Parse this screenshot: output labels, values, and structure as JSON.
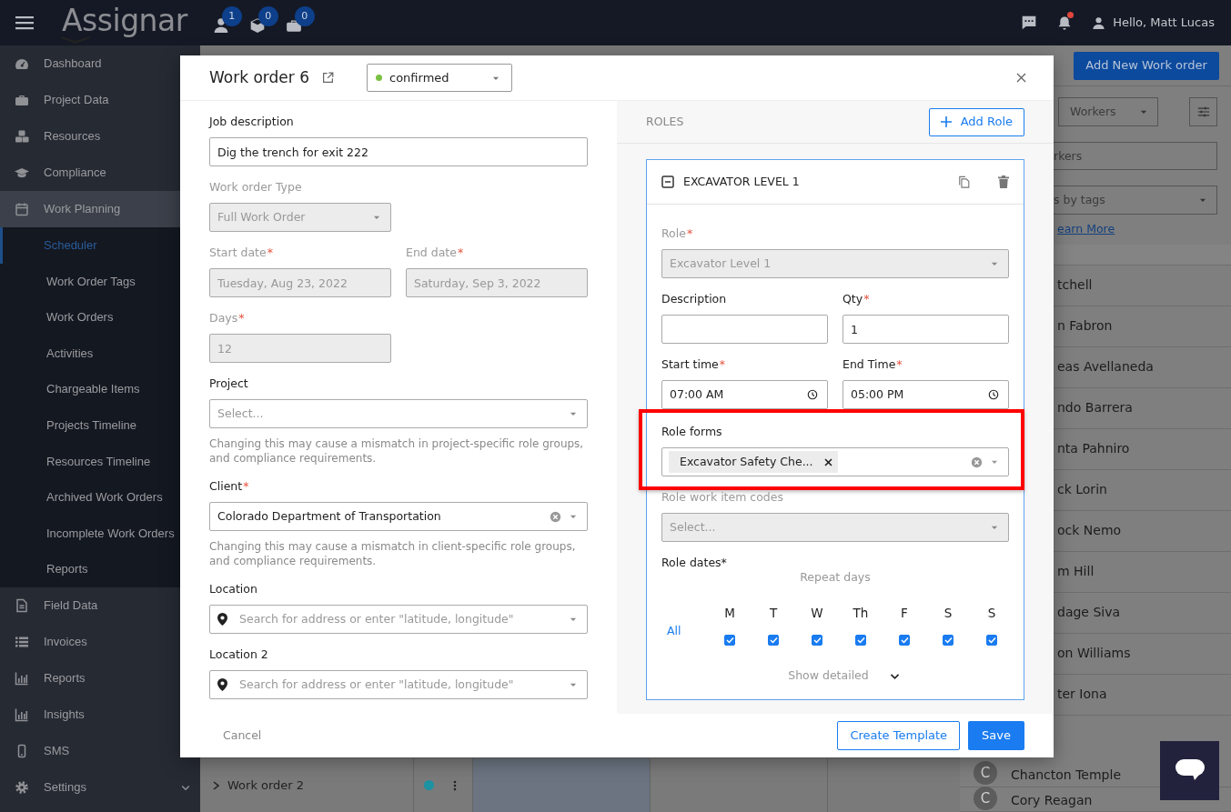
{
  "topbar": {
    "logo": "Assignar",
    "badges": [
      "1",
      "0",
      "0"
    ],
    "notification": true,
    "greeting": "Hello, Matt Lucas"
  },
  "sidebar": {
    "items": [
      {
        "label": "Dashboard",
        "selected": false
      },
      {
        "label": "Project Data",
        "selected": false
      },
      {
        "label": "Resources",
        "selected": false
      },
      {
        "label": "Compliance",
        "selected": false
      },
      {
        "label": "Work Planning",
        "selected": true,
        "expanded": true,
        "children": [
          {
            "label": "Scheduler",
            "selected": true
          },
          {
            "label": "Work Order Tags",
            "selected": false
          },
          {
            "label": "Work Orders",
            "selected": false
          },
          {
            "label": "Activities",
            "selected": false
          },
          {
            "label": "Chargeable Items",
            "selected": false
          },
          {
            "label": "Projects Timeline",
            "selected": false
          },
          {
            "label": "Resources Timeline",
            "selected": false
          },
          {
            "label": "Archived Work Orders",
            "selected": false
          },
          {
            "label": "Incomplete Work Orders",
            "selected": false
          },
          {
            "label": "Reports",
            "selected": false
          }
        ]
      },
      {
        "label": "Field Data",
        "selected": false
      },
      {
        "label": "Invoices",
        "selected": false
      },
      {
        "label": "Reports",
        "selected": false
      },
      {
        "label": "Insights",
        "selected": false
      },
      {
        "label": "SMS",
        "selected": false
      },
      {
        "label": "Settings",
        "selected": false,
        "expanded": false
      }
    ]
  },
  "scheduler_row": {
    "label": "Work order 2",
    "color": "#1b93a3"
  },
  "right_panel": {
    "add_button": "Add New Work order",
    "filter_select": "Workers",
    "search": {
      "placeholder": "rkers"
    },
    "tags_select": {
      "placeholder": "s by tags"
    },
    "link": "earn More",
    "workers": [
      {
        "name": "tchell"
      },
      {
        "name": "n Fabron"
      },
      {
        "name": "eas Avellaneda"
      },
      {
        "name": "ndo Barrera"
      },
      {
        "name": "nta Pahniro"
      },
      {
        "name": "ck Lorin"
      },
      {
        "name": "ock Nemo"
      },
      {
        "name": "m Hill"
      },
      {
        "name": "dage Siva"
      },
      {
        "name": "on Williams"
      },
      {
        "name": "ter Iona"
      },
      {
        "name": "Chancton Temple",
        "avatar": "C"
      },
      {
        "name": "Cory Reagan",
        "avatar": "C"
      }
    ]
  },
  "modal": {
    "title": "Work order 6",
    "status": {
      "value": "confirmed",
      "color": "#7ac143"
    },
    "rows": [
      [
        {
          "label": "Job description",
          "kind": "input",
          "value": "Dig the trench for exit 222"
        }
      ],
      [
        {
          "label": "Work order Type",
          "kind": "short-select",
          "value": "Full Work Order",
          "disabled": true
        }
      ],
      [
        {
          "label": "Start date",
          "mark": "*",
          "kind": "input",
          "value": "Tuesday, Aug 23, 2022",
          "disabled": true
        },
        {
          "label": "End date",
          "mark": "*",
          "kind": "input",
          "value": "Saturday, Sep 3, 2022",
          "disabled": true
        }
      ],
      [
        {
          "label": "Days",
          "mark": "*",
          "kind": "short-input",
          "value": "12",
          "disabled": true
        }
      ],
      [
        {
          "label": "Project",
          "kind": "select",
          "placeholder": "Select...",
          "help": "Changing this may cause a mismatch in project-specific role groups, and compliance requirements."
        }
      ],
      [
        {
          "label": "Client",
          "mark": "*",
          "kind": "select",
          "value": "Colorado Department of Transportation",
          "clearable": true,
          "help": "Changing this may cause a mismatch in client-specific role groups, and compliance requirements."
        }
      ],
      [
        {
          "label": "Location",
          "kind": "location",
          "placeholder": "Search for address or enter \"latitude, longitude\""
        }
      ],
      [
        {
          "label": "Location 2",
          "kind": "location",
          "placeholder": "Search for address or enter \"latitude, longitude\""
        }
      ]
    ],
    "roles": {
      "heading": "ROLES",
      "add_button": "Add Role",
      "cards": [
        {
          "title": "EXCAVATOR LEVEL 1",
          "expanded": true,
          "rows": [
            [
              {
                "label": "Role",
                "mark": "*",
                "kind": "select",
                "value": "Excavator Level 1",
                "disabled": true
              }
            ],
            [
              {
                "label": "Description",
                "kind": "input"
              },
              {
                "label": "Qty",
                "mark": "*",
                "kind": "input",
                "value": "1"
              }
            ],
            [
              {
                "label": "Start time",
                "mark": "*",
                "kind": "time",
                "value": "07:00 AM"
              },
              {
                "label": "End Time",
                "mark": "*",
                "kind": "time",
                "value": "05:00 PM"
              }
            ],
            [
              {
                "label": "Role forms",
                "kind": "tags",
                "tags": [
                  "Excavator Safety Che..."
                ],
                "clearable": true,
                "highlighted": true
              }
            ],
            [
              {
                "label": "Role work item codes",
                "kind": "select",
                "placeholder": "Select...",
                "disabled": true
              }
            ]
          ],
          "role_dates": {
            "label": "Role dates",
            "mark": "*",
            "caption": "Repeat days",
            "all_link": "All",
            "days": [
              {
                "label": "M",
                "checked": true
              },
              {
                "label": "T",
                "checked": true
              },
              {
                "label": "W",
                "checked": true
              },
              {
                "label": "Th",
                "checked": true
              },
              {
                "label": "F",
                "checked": true
              },
              {
                "label": "S",
                "checked": true
              },
              {
                "label": "S",
                "checked": true
              }
            ],
            "toggle": "Show detailed"
          }
        }
      ]
    },
    "footer": {
      "cancel": "Cancel",
      "template_button": "Create Template",
      "save_button": "Save"
    }
  }
}
